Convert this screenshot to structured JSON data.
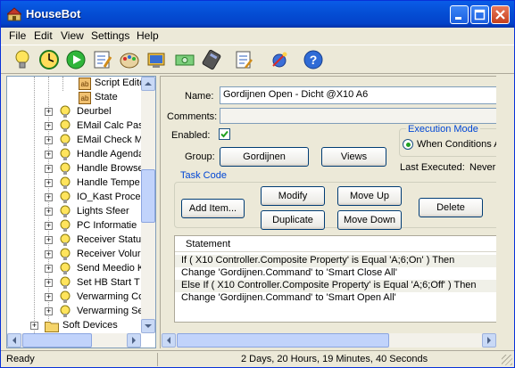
{
  "window": {
    "title": "HouseBot"
  },
  "menu": [
    "File",
    "Edit",
    "View",
    "Settings",
    "Help"
  ],
  "toolbar": {
    "icons": [
      "lightbulb-icon",
      "schedule-icon",
      "play-icon",
      "edit-icon",
      "palette-icon",
      "device-icon",
      "money-icon",
      "remote-icon",
      "report-icon",
      "satellite-icon",
      "help-icon"
    ]
  },
  "tree": {
    "rows": [
      {
        "label": "Script Edito",
        "kind": "leaf",
        "expander": ""
      },
      {
        "label": "State",
        "kind": "leaf",
        "expander": ""
      },
      {
        "label": "Deurbel",
        "kind": "device",
        "expander": "+"
      },
      {
        "label": "EMail Calc Pass",
        "kind": "device",
        "expander": "+"
      },
      {
        "label": "EMail Check Me",
        "kind": "device",
        "expander": "+"
      },
      {
        "label": "Handle Agenda",
        "kind": "device",
        "expander": "+"
      },
      {
        "label": "Handle Browse",
        "kind": "device",
        "expander": "+"
      },
      {
        "label": "Handle Tempe",
        "kind": "device",
        "expander": "+"
      },
      {
        "label": "IO_Kast Proce",
        "kind": "device",
        "expander": "+"
      },
      {
        "label": "Lights Sfeer",
        "kind": "device",
        "expander": "+"
      },
      {
        "label": "PC Informatie",
        "kind": "device",
        "expander": "+"
      },
      {
        "label": "Receiver Statu",
        "kind": "device",
        "expander": "+"
      },
      {
        "label": "Receiver Volur",
        "kind": "device",
        "expander": "+"
      },
      {
        "label": "Send Meedio K",
        "kind": "device",
        "expander": "+"
      },
      {
        "label": "Set HB Start T",
        "kind": "device",
        "expander": "+"
      },
      {
        "label": "Verwarming Co",
        "kind": "device",
        "expander": "+"
      },
      {
        "label": "Verwarming Se",
        "kind": "device",
        "expander": "+"
      },
      {
        "label": "Soft Devices",
        "kind": "folder",
        "expander": "+"
      }
    ]
  },
  "task": {
    "name_label": "Name:",
    "name_value": "Gordijnen Open - Dicht @X10 A6",
    "comments_label": "Comments:",
    "comments_value": "",
    "enabled_label": "Enabled:",
    "enabled_checked": true,
    "group_label": "Group:",
    "group_button": "Gordijnen",
    "views_button": "Views",
    "execution_mode_title": "Execution Mode",
    "execution_mode_option": "When Conditions A",
    "last_executed_label": "Last Executed:",
    "last_executed_value": "Never",
    "task_code_title": "Task Code",
    "buttons": {
      "add_item": "Add Item...",
      "modify": "Modify",
      "duplicate": "Duplicate",
      "move_up": "Move Up",
      "move_down": "Move Down",
      "delete": "Delete"
    },
    "statement_header": "Statement",
    "statements": [
      "If ( X10 Controller.Composite Property' is Equal 'A;6;On' )  Then",
      "     Change 'Gordijnen.Command' to 'Smart Close All'",
      "Else If ( X10 Controller.Composite Property' is Equal 'A;6;Off' )  Then",
      "     Change 'Gordijnen.Command' to 'Smart Open All'"
    ]
  },
  "status": {
    "left": "Ready",
    "uptime": "2 Days, 20 Hours, 19 Minutes, 40 Seconds"
  },
  "colors": {
    "titlebar": "#0550d6",
    "window_face": "#ece9d8",
    "group_title": "#0046d5",
    "row_stripe": "#f0f0e8"
  }
}
